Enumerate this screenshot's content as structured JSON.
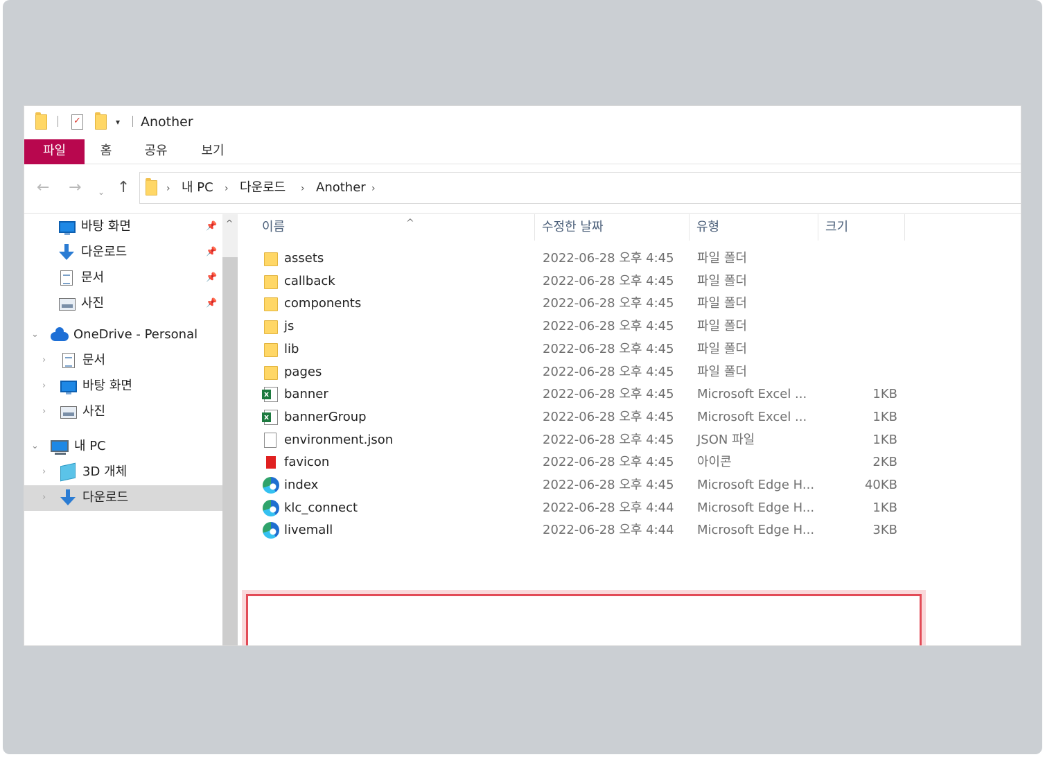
{
  "window": {
    "title": "Another"
  },
  "quick_access_toolbar": {
    "dropdown_glyph": "▾"
  },
  "ribbon": {
    "tabs": [
      {
        "label": "파일",
        "active": true
      },
      {
        "label": "홈"
      },
      {
        "label": "공유"
      },
      {
        "label": "보기"
      }
    ],
    "active_color": "#b8074e"
  },
  "navigation": {
    "back_glyph": "←",
    "forward_glyph": "→",
    "recent_glyph": "⌄",
    "up_glyph": "↑"
  },
  "address_bar": {
    "breadcrumbs": [
      "내 PC",
      "다운로드",
      "Another"
    ],
    "separator": "›"
  },
  "nav_pane": {
    "items": [
      {
        "label": "바탕 화면",
        "icon": "desktop-icon",
        "pinned": true
      },
      {
        "label": "다운로드",
        "icon": "download-icon",
        "pinned": true
      },
      {
        "label": "문서",
        "icon": "document-icon",
        "pinned": true
      },
      {
        "label": "사진",
        "icon": "pictures-icon",
        "pinned": true
      },
      {
        "label": "OneDrive - Personal",
        "icon": "onedrive-icon",
        "expanded": true
      },
      {
        "label": "문서",
        "icon": "document-icon"
      },
      {
        "label": "바탕 화면",
        "icon": "desktop-icon"
      },
      {
        "label": "사진",
        "icon": "pictures-icon"
      },
      {
        "label": "내 PC",
        "icon": "pc-icon",
        "expanded": true
      },
      {
        "label": "3D 개체",
        "icon": "3d-objects-icon"
      },
      {
        "label": "다운로드",
        "icon": "download-icon",
        "selected": true
      }
    ],
    "pin_glyph": "📌",
    "collapsed_glyph": "›",
    "expanded_glyph": "⌄",
    "scroll_up_glyph": "^"
  },
  "file_list": {
    "columns": {
      "name": "이름",
      "date": "수정한 날짜",
      "type": "유형",
      "size": "크기"
    },
    "sort_glyph": "^",
    "rows": [
      {
        "name": "assets",
        "date": "2022-06-28 오후 4:45",
        "type": "파일 폴더",
        "size": "",
        "icon": "folder-icon"
      },
      {
        "name": "callback",
        "date": "2022-06-28 오후 4:45",
        "type": "파일 폴더",
        "size": "",
        "icon": "folder-icon"
      },
      {
        "name": "components",
        "date": "2022-06-28 오후 4:45",
        "type": "파일 폴더",
        "size": "",
        "icon": "folder-icon"
      },
      {
        "name": "js",
        "date": "2022-06-28 오후 4:45",
        "type": "파일 폴더",
        "size": "",
        "icon": "folder-icon"
      },
      {
        "name": "lib",
        "date": "2022-06-28 오후 4:45",
        "type": "파일 폴더",
        "size": "",
        "icon": "folder-icon"
      },
      {
        "name": "pages",
        "date": "2022-06-28 오후 4:45",
        "type": "파일 폴더",
        "size": "",
        "icon": "folder-icon"
      },
      {
        "name": "banner",
        "date": "2022-06-28 오후 4:45",
        "type": "Microsoft Excel ...",
        "size": "1KB",
        "icon": "excel-icon"
      },
      {
        "name": "bannerGroup",
        "date": "2022-06-28 오후 4:45",
        "type": "Microsoft Excel ...",
        "size": "1KB",
        "icon": "excel-icon"
      },
      {
        "name": "environment.json",
        "date": "2022-06-28 오후 4:45",
        "type": "JSON 파일",
        "size": "1KB",
        "icon": "file-icon"
      },
      {
        "name": "favicon",
        "date": "2022-06-28 오후 4:45",
        "type": "아이콘",
        "size": "2KB",
        "icon": "favicon-icon"
      },
      {
        "name": "index",
        "date": "2022-06-28 오후 4:45",
        "type": "Microsoft Edge H...",
        "size": "40KB",
        "icon": "edge-icon"
      },
      {
        "name": "klc_connect",
        "date": "2022-06-28 오후 4:44",
        "type": "Microsoft Edge H...",
        "size": "1KB",
        "icon": "edge-icon"
      },
      {
        "name": "livemall",
        "date": "2022-06-28 오후 4:44",
        "type": "Microsoft Edge H...",
        "size": "3KB",
        "icon": "edge-icon"
      }
    ],
    "highlight_color": "#e24b57"
  }
}
